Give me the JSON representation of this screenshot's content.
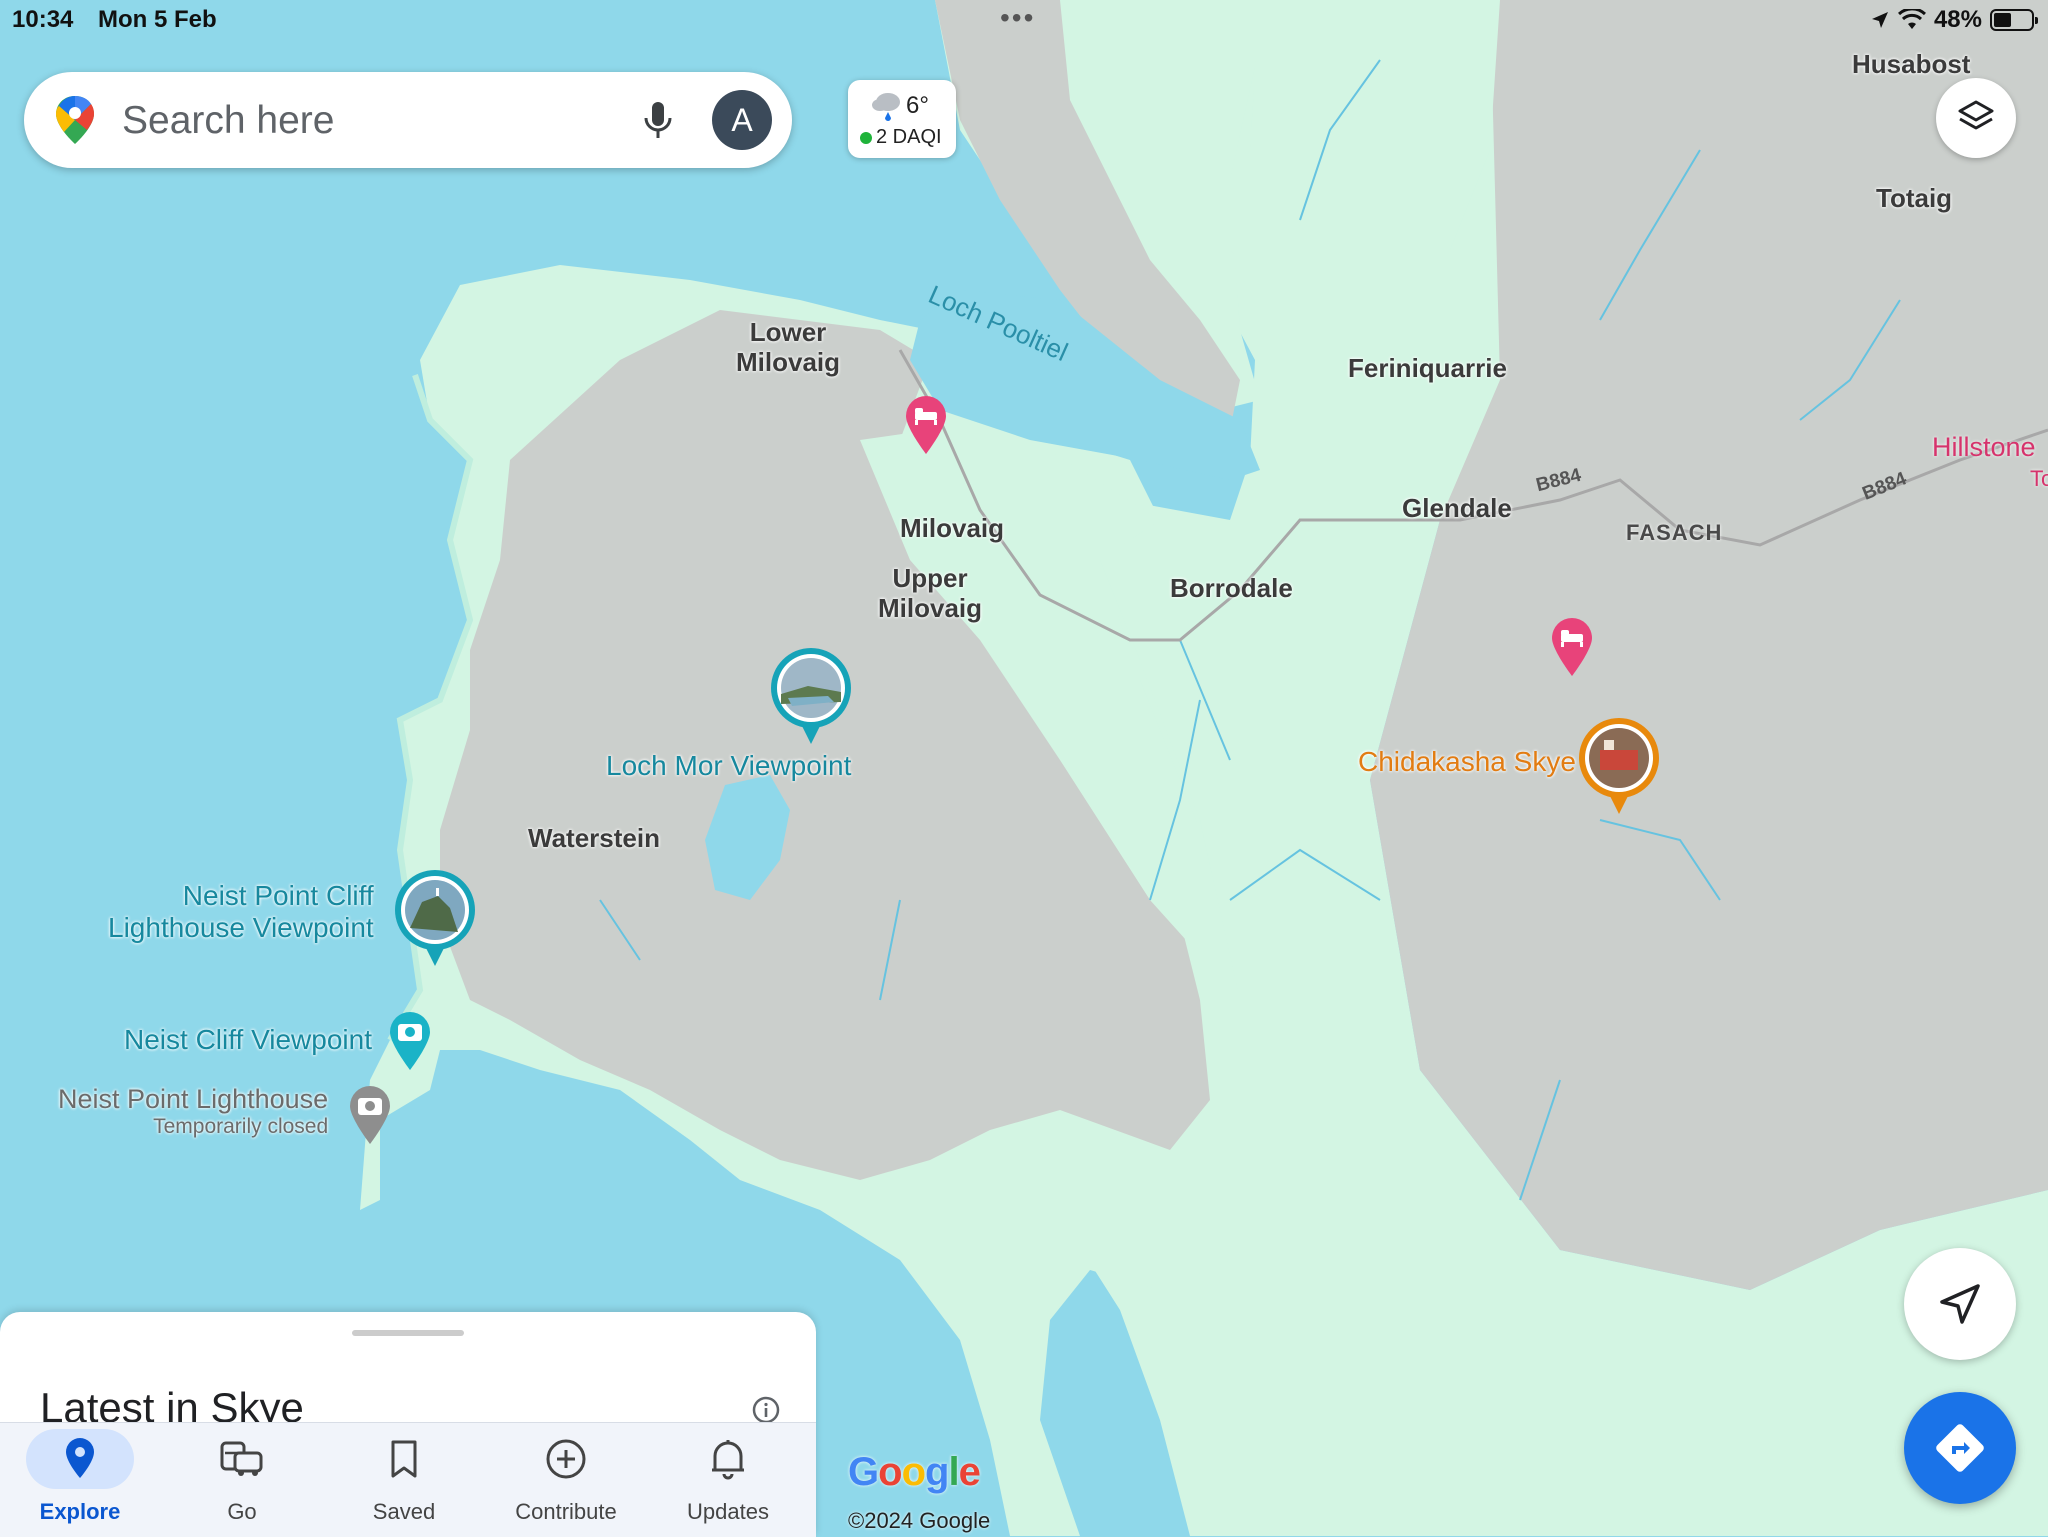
{
  "status_bar": {
    "time": "10:34",
    "date": "Mon 5 Feb",
    "battery": "48%",
    "battery_level": 0.48
  },
  "search": {
    "placeholder": "Search here",
    "avatar_letter": "A"
  },
  "weather": {
    "temperature": "6°",
    "aqi": "2 DAQI"
  },
  "map": {
    "places": {
      "husabost": "Husabost",
      "totaig": "Totaig",
      "lower_milovaig": "Lower\nMilovaig",
      "feriniquarrie": "Feriniquarrie",
      "glendale": "Glendale",
      "fasach": "FASACH",
      "milovaig": "Milovaig",
      "upper_milovaig": "Upper\nMilovaig",
      "borrodale": "Borrodale",
      "waterstein": "Waterstein"
    },
    "water": {
      "loch_pooltiel": "Loch Pooltiel"
    },
    "roads": {
      "b884_a": "B884",
      "b884_b": "B884"
    },
    "pois": {
      "hillstone": "Hillstone",
      "hillstone_cut": "To",
      "loch_mor": "Loch Mor Viewpoint",
      "chidakasha": "Chidakasha Skye",
      "neist_point_cliff": "Neist Point Cliff\nLighthouse Viewpoint",
      "neist_cliff": "Neist Cliff Viewpoint",
      "neist_lighthouse": "Neist Point Lighthouse",
      "neist_lighthouse_status": "Temporarily closed"
    },
    "attribution": {
      "logo": "Google",
      "copyright": "©2024 Google"
    },
    "colors": {
      "water": "#8fd8ea",
      "land": "#cbcfcc",
      "green": "#d3f5e3",
      "teal_poi": "#16889e",
      "orange_poi": "#e27c12",
      "hotel_pin": "#e8437a"
    }
  },
  "bottom_sheet": {
    "title": "Latest in Skye"
  },
  "nav": {
    "explore": "Explore",
    "go": "Go",
    "saved": "Saved",
    "contribute": "Contribute",
    "updates": "Updates"
  }
}
